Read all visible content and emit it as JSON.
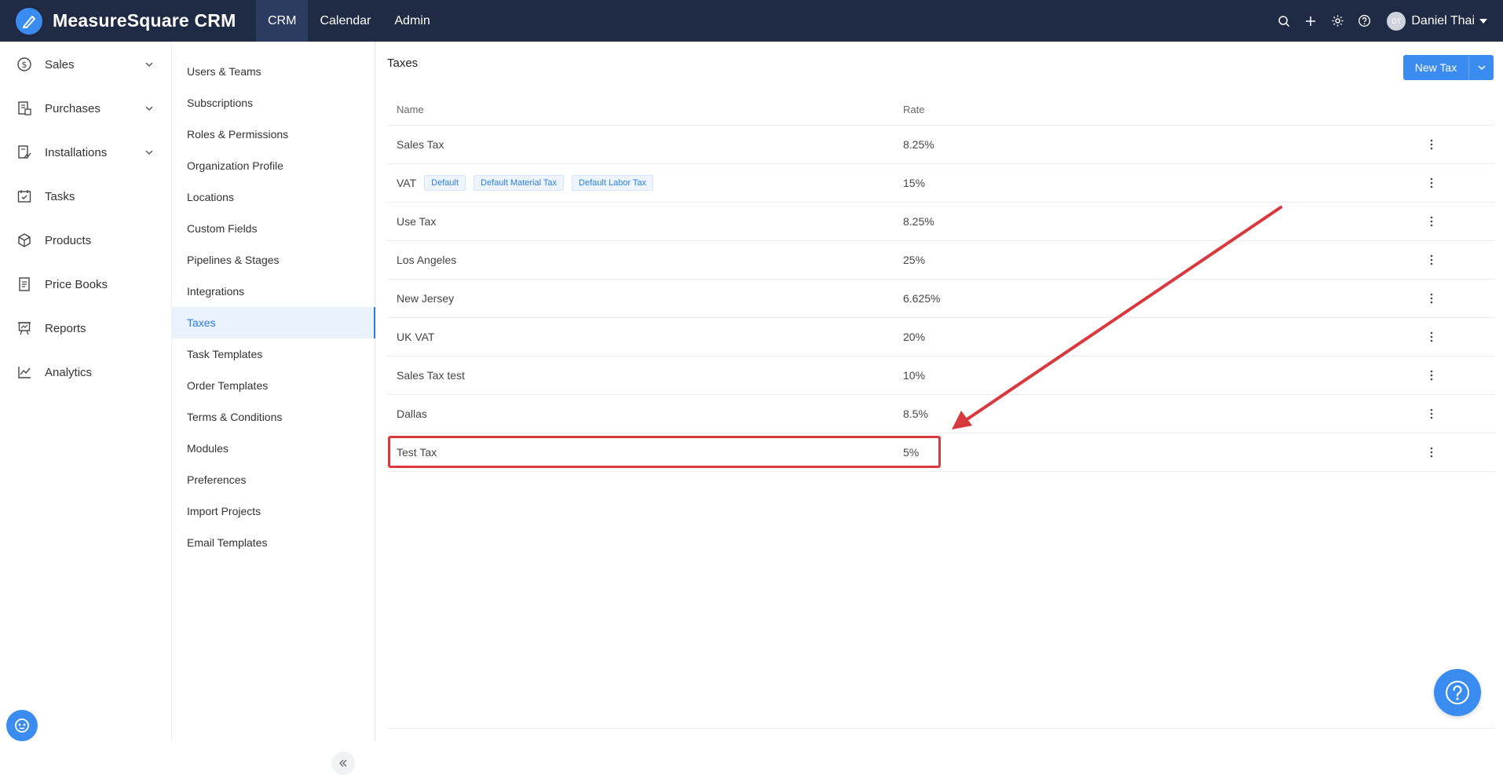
{
  "app": {
    "name": "MeasureSquare CRM"
  },
  "topnav": {
    "items": [
      {
        "label": "CRM",
        "active": true
      },
      {
        "label": "Calendar",
        "active": false
      },
      {
        "label": "Admin",
        "active": false
      }
    ]
  },
  "user": {
    "initials": "DT",
    "name": "Daniel Thai"
  },
  "sidebar": {
    "items": [
      {
        "label": "Sales",
        "icon": "dollar-circle-icon",
        "expandable": true
      },
      {
        "label": "Purchases",
        "icon": "purchase-doc-icon",
        "expandable": true
      },
      {
        "label": "Installations",
        "icon": "installation-icon",
        "expandable": true
      },
      {
        "label": "Tasks",
        "icon": "calendar-check-icon",
        "expandable": false
      },
      {
        "label": "Products",
        "icon": "box-icon",
        "expandable": false
      },
      {
        "label": "Price Books",
        "icon": "document-icon",
        "expandable": false
      },
      {
        "label": "Reports",
        "icon": "presentation-board-icon",
        "expandable": false
      },
      {
        "label": "Analytics",
        "icon": "line-chart-icon",
        "expandable": false
      }
    ]
  },
  "subnav": {
    "items": [
      "Users & Teams",
      "Subscriptions",
      "Roles & Permissions",
      "Organization Profile",
      "Locations",
      "Custom Fields",
      "Pipelines & Stages",
      "Integrations",
      "Taxes",
      "Task Templates",
      "Order Templates",
      "Terms & Conditions",
      "Modules",
      "Preferences",
      "Import Projects",
      "Email Templates"
    ],
    "active": "Taxes"
  },
  "page": {
    "title": "Taxes",
    "new_button": "New Tax"
  },
  "table": {
    "columns": [
      "Name",
      "Rate"
    ],
    "rows": [
      {
        "name": "Sales Tax",
        "rate": "8.25%",
        "badges": []
      },
      {
        "name": "VAT",
        "rate": "15%",
        "badges": [
          "Default",
          "Default Material Tax",
          "Default Labor Tax"
        ]
      },
      {
        "name": "Use Tax",
        "rate": "8.25%",
        "badges": []
      },
      {
        "name": "Los Angeles",
        "rate": "25%",
        "badges": []
      },
      {
        "name": "New Jersey",
        "rate": "6.625%",
        "badges": []
      },
      {
        "name": "UK VAT",
        "rate": "20%",
        "badges": []
      },
      {
        "name": "Sales Tax test",
        "rate": "10%",
        "badges": []
      },
      {
        "name": "Dallas",
        "rate": "8.5%",
        "badges": []
      },
      {
        "name": "Test Tax",
        "rate": "5%",
        "badges": [],
        "highlighted": true
      }
    ]
  },
  "colors": {
    "topbar": "#1f2a44",
    "accent": "#3b8cf0",
    "annotation": "#d9383c"
  }
}
